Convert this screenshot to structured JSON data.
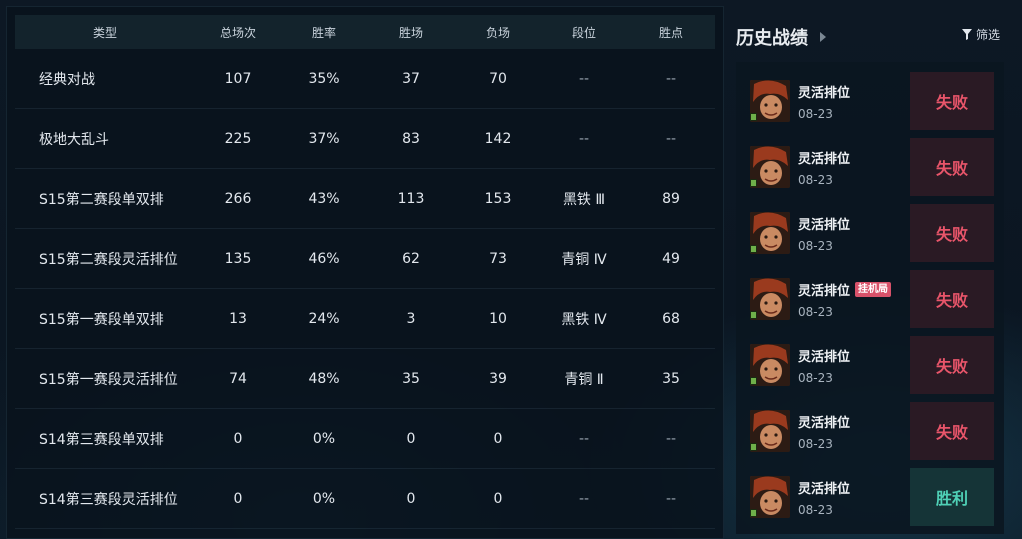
{
  "table": {
    "headers": {
      "type": "类型",
      "total": "总场次",
      "rate": "胜率",
      "wins": "胜场",
      "losses": "负场",
      "tier": "段位",
      "lp": "胜点"
    },
    "rows": [
      {
        "type": "经典对战",
        "total": "107",
        "rate": "35%",
        "wins": "37",
        "losses": "70",
        "tier": "--",
        "lp": "--"
      },
      {
        "type": "极地大乱斗",
        "total": "225",
        "rate": "37%",
        "wins": "83",
        "losses": "142",
        "tier": "--",
        "lp": "--"
      },
      {
        "type": "S15第二赛段单双排",
        "total": "266",
        "rate": "43%",
        "wins": "113",
        "losses": "153",
        "tier": "黑铁 Ⅲ",
        "lp": "89"
      },
      {
        "type": "S15第二赛段灵活排位",
        "total": "135",
        "rate": "46%",
        "wins": "62",
        "losses": "73",
        "tier": "青铜 Ⅳ",
        "lp": "49"
      },
      {
        "type": "S15第一赛段单双排",
        "total": "13",
        "rate": "24%",
        "wins": "3",
        "losses": "10",
        "tier": "黑铁 Ⅳ",
        "lp": "68"
      },
      {
        "type": "S15第一赛段灵活排位",
        "total": "74",
        "rate": "48%",
        "wins": "35",
        "losses": "39",
        "tier": "青铜 Ⅱ",
        "lp": "35"
      },
      {
        "type": "S14第三赛段单双排",
        "total": "0",
        "rate": "0%",
        "wins": "0",
        "losses": "0",
        "tier": "--",
        "lp": "--"
      },
      {
        "type": "S14第三赛段灵活排位",
        "total": "0",
        "rate": "0%",
        "wins": "0",
        "losses": "0",
        "tier": "--",
        "lp": "--"
      }
    ]
  },
  "history": {
    "title": "历史战绩",
    "filter_label": "筛选",
    "filter_icon": "filter-icon",
    "matches": [
      {
        "mode": "灵活排位",
        "date": "08-23",
        "result": "失败",
        "outcome": "lose",
        "tag": ""
      },
      {
        "mode": "灵活排位",
        "date": "08-23",
        "result": "失败",
        "outcome": "lose",
        "tag": ""
      },
      {
        "mode": "灵活排位",
        "date": "08-23",
        "result": "失败",
        "outcome": "lose",
        "tag": ""
      },
      {
        "mode": "灵活排位",
        "date": "08-23",
        "result": "失败",
        "outcome": "lose",
        "tag": "挂机局"
      },
      {
        "mode": "灵活排位",
        "date": "08-23",
        "result": "失败",
        "outcome": "lose",
        "tag": ""
      },
      {
        "mode": "灵活排位",
        "date": "08-23",
        "result": "失败",
        "outcome": "lose",
        "tag": ""
      },
      {
        "mode": "灵活排位",
        "date": "08-23",
        "result": "胜利",
        "outcome": "win",
        "tag": ""
      }
    ]
  },
  "colors": {
    "lose_text": "#e8556a",
    "win_text": "#4fd0b6",
    "afk_tag_bg": "#d8526a",
    "header_bg": "#13232c"
  }
}
